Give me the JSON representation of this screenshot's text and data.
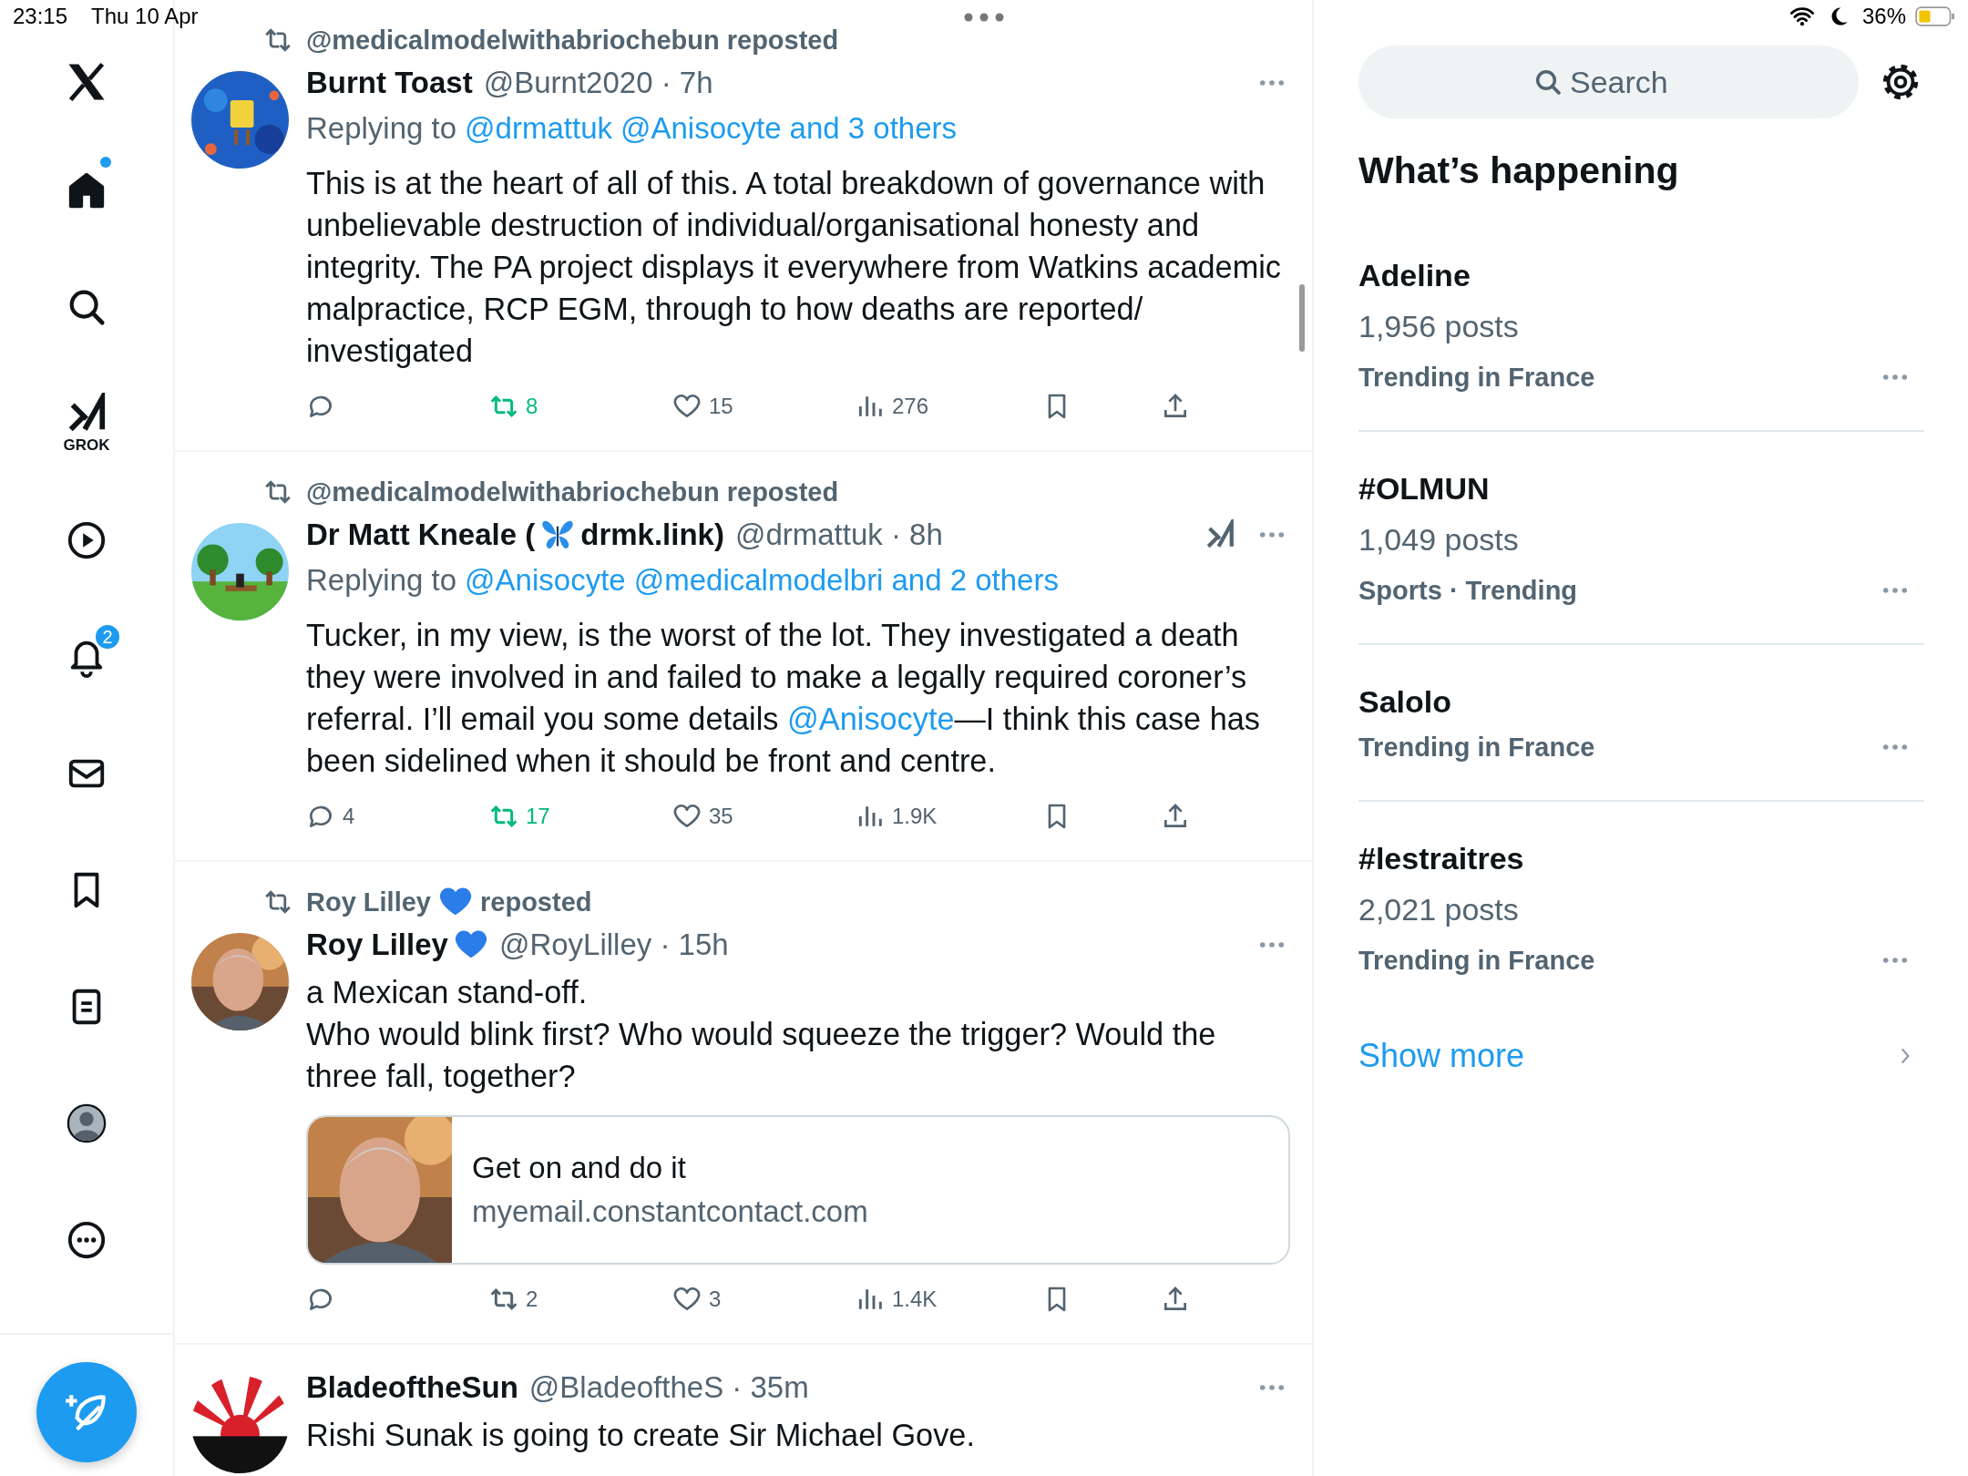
{
  "status_bar": {
    "time": "23:15",
    "date": "Thu 10 Apr",
    "battery": "36%"
  },
  "sidebar": {
    "items": [
      {
        "kind": "home",
        "selected": true,
        "dot": true
      },
      {
        "kind": "search",
        "selected": false
      },
      {
        "kind": "grok",
        "selected": false,
        "label": "GROK"
      },
      {
        "kind": "video",
        "selected": false
      },
      {
        "kind": "notifications",
        "selected": false,
        "badge": "2"
      },
      {
        "kind": "messages",
        "selected": false
      },
      {
        "kind": "bookmarks",
        "selected": false
      },
      {
        "kind": "lists",
        "selected": false
      },
      {
        "kind": "profile",
        "selected": false
      },
      {
        "kind": "more",
        "selected": false
      }
    ]
  },
  "tweets": [
    {
      "reposted_by": [
        {
          "text": "@medicalmodelwithabriochebun reposted"
        }
      ],
      "name": [
        {
          "text": "Burnt Toast"
        }
      ],
      "meta": "@Burnt2020 · 7h",
      "grok": false,
      "replying": {
        "label": "Replying to",
        "mentions": [
          "@drmattuk",
          "@Anisocyte",
          "and 3 others"
        ]
      },
      "body": [
        [
          {
            "text": "This is at the heart of all of this. A total breakdown of governance with unbelievable destruction of individual/organisational honesty and integrity. The PA project displays it everywhere from Watkins academic malpractice, RCP EGM, through to how deaths are reported/ investigated"
          }
        ]
      ],
      "actions": {
        "reposts": "8",
        "reposted": true,
        "likes": "15",
        "views": "276"
      }
    },
    {
      "reposted_by": [
        {
          "text": "@medicalmodelwithabriochebun reposted"
        }
      ],
      "name": [
        {
          "text": "Dr Matt Kneale ("
        },
        {
          "kind": "butterfly"
        },
        {
          "text": "drmk.link)"
        }
      ],
      "meta": "@drmattuk · 8h",
      "grok": true,
      "replying": {
        "label": "Replying to",
        "mentions": [
          "@Anisocyte",
          "@medicalmodelbri",
          "and 2 others"
        ]
      },
      "body": [
        [
          {
            "text": "Tucker, in my view, is the worst of the lot. They investigated a death they were involved in and failed to make a legally required coroner’s referral. I’ll email you some details "
          },
          {
            "text": "@Anisocyte",
            "link": true
          },
          {
            "text": "—I think this case has been sidelined when it should be front and centre."
          }
        ]
      ],
      "actions": {
        "replies": "4",
        "reposts": "17",
        "reposted": true,
        "likes": "35",
        "views": "1.9K"
      }
    },
    {
      "reposted_by": [
        {
          "text": "Roy Lilley"
        },
        {
          "kind": "heart"
        },
        {
          "text": "reposted"
        }
      ],
      "name": [
        {
          "text": "Roy Lilley"
        },
        {
          "kind": "heart"
        }
      ],
      "meta": "@RoyLilley · 15h",
      "grok": false,
      "body": [
        [
          {
            "text": "a Mexican stand-off."
          }
        ],
        [
          {
            "text": "Who would blink first? Who would squeeze the trigger? Would the three fall, together?"
          }
        ]
      ],
      "card": {
        "title": "Get on and do it",
        "domain": "myemail.constantcontact.com"
      },
      "actions": {
        "reposts": "2",
        "reposted": false,
        "likes": "3",
        "views": "1.4K"
      }
    },
    {
      "name": [
        {
          "text": "BladeoftheSun"
        }
      ],
      "meta": "@BladeoftheS · 35m",
      "grok": false,
      "body": [
        [
          {
            "text": "Rishi Sunak is going to create Sir Michael Gove."
          }
        ]
      ]
    }
  ],
  "search": {
    "placeholder": "Search"
  },
  "trends": {
    "title": "What’s happening",
    "items": [
      {
        "name": "Adeline",
        "posts": "1,956 posts",
        "category": "Trending in France"
      },
      {
        "name": "#OLMUN",
        "posts": "1,049 posts",
        "category": "Sports · Trending"
      },
      {
        "name": "Salolo",
        "category": "Trending in France"
      },
      {
        "name": "#lestraitres",
        "posts": "2,021 posts",
        "category": "Trending in France"
      }
    ],
    "show_more": "Show more"
  }
}
